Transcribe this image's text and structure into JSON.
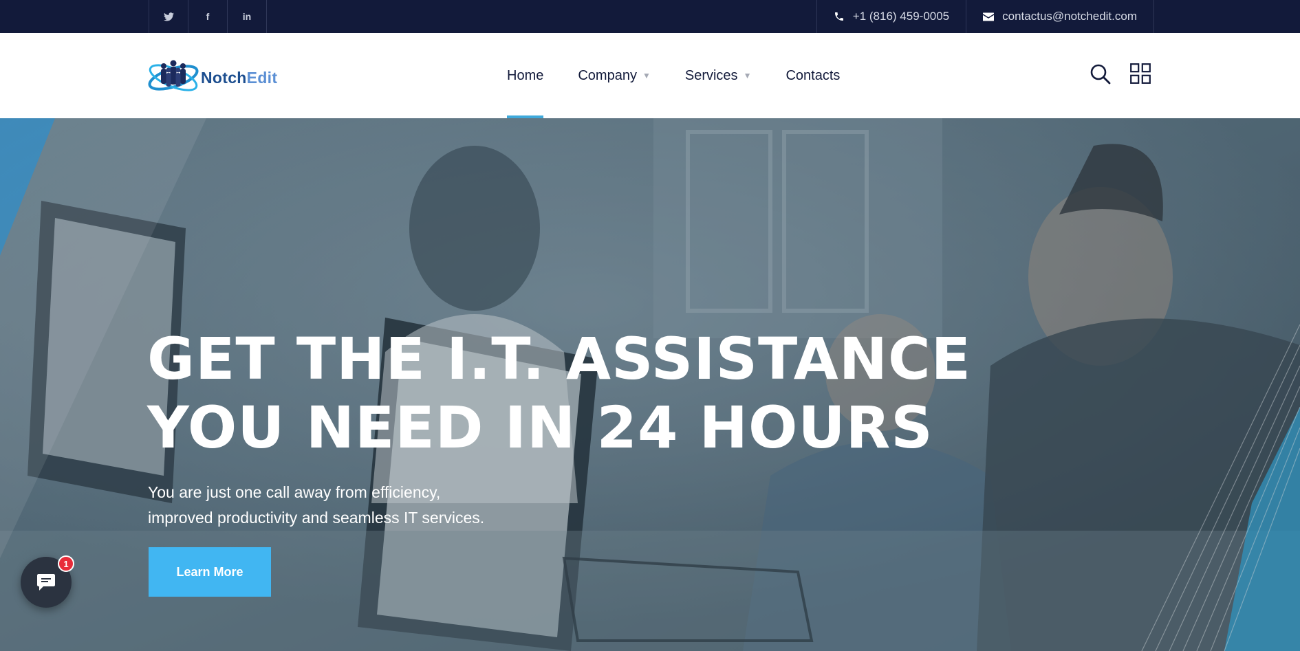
{
  "topbar": {
    "social": [
      {
        "name": "twitter-icon",
        "glyph": "🐦"
      },
      {
        "name": "facebook-icon",
        "glyph": "f"
      },
      {
        "name": "linkedin-icon",
        "glyph": "in"
      }
    ],
    "phone": "+1 (816) 459-0005",
    "email": "contactus@notchedit.com"
  },
  "logo": {
    "part1": "Notch",
    "part2": "Edit"
  },
  "nav": {
    "home": "Home",
    "company": "Company",
    "services": "Services",
    "contacts": "Contacts",
    "dropdown_glyph": "▼"
  },
  "hero": {
    "headline_line1": "GET THE I.T. ASSISTANCE",
    "headline_line2": "YOU NEED IN 24 HOURS",
    "sub_line1": "You are just one call away from efficiency,",
    "sub_line2": "improved productivity and seamless IT services.",
    "cta": "Learn More"
  },
  "chat": {
    "badge_count": "1"
  },
  "colors": {
    "topbar": "#121a3a",
    "accent": "#41b6f2",
    "nav_underline": "#3fa9db",
    "badge": "#e82c3a"
  }
}
